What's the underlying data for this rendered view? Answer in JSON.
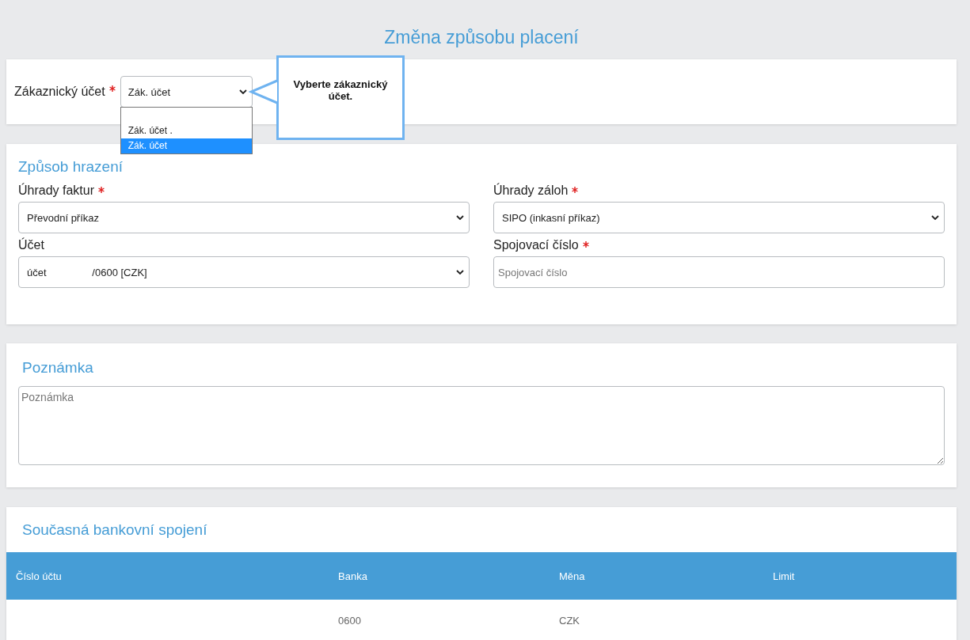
{
  "title": "Změna způsobu placení",
  "customer_account": {
    "label": "Zákaznický účet",
    "required": true,
    "value": "Zák. účet",
    "expanded": true,
    "options": [
      {
        "label": "Zák. účet .",
        "selected": false
      },
      {
        "label": "Zák. účet",
        "selected": true
      }
    ]
  },
  "tooltip": {
    "text": "Vyberte zákaznický účet."
  },
  "payment_section": {
    "heading": "Způsob hrazení",
    "fields": [
      {
        "kind": "select",
        "label": "Úhrady faktur",
        "required": true,
        "value": "Převodní příkaz"
      },
      {
        "kind": "select",
        "label": "Úhrady záloh",
        "required": true,
        "value": "SIPO (inkasní příkaz)"
      },
      {
        "kind": "select",
        "label": "Účet",
        "required": false,
        "value": "účet                /0600 [CZK]"
      },
      {
        "kind": "input",
        "label": "Spojovací číslo",
        "required": true,
        "placeholder": "Spojovací číslo"
      }
    ]
  },
  "note_section": {
    "heading": "Poznámka",
    "placeholder": "Poznámka"
  },
  "bank_section": {
    "heading": "Současná bankovní spojení",
    "columns": [
      "Číslo účtu",
      "Banka",
      "Měna",
      "Limit"
    ],
    "rows": [
      {
        "bank": "0600",
        "currency": "CZK"
      }
    ]
  }
}
